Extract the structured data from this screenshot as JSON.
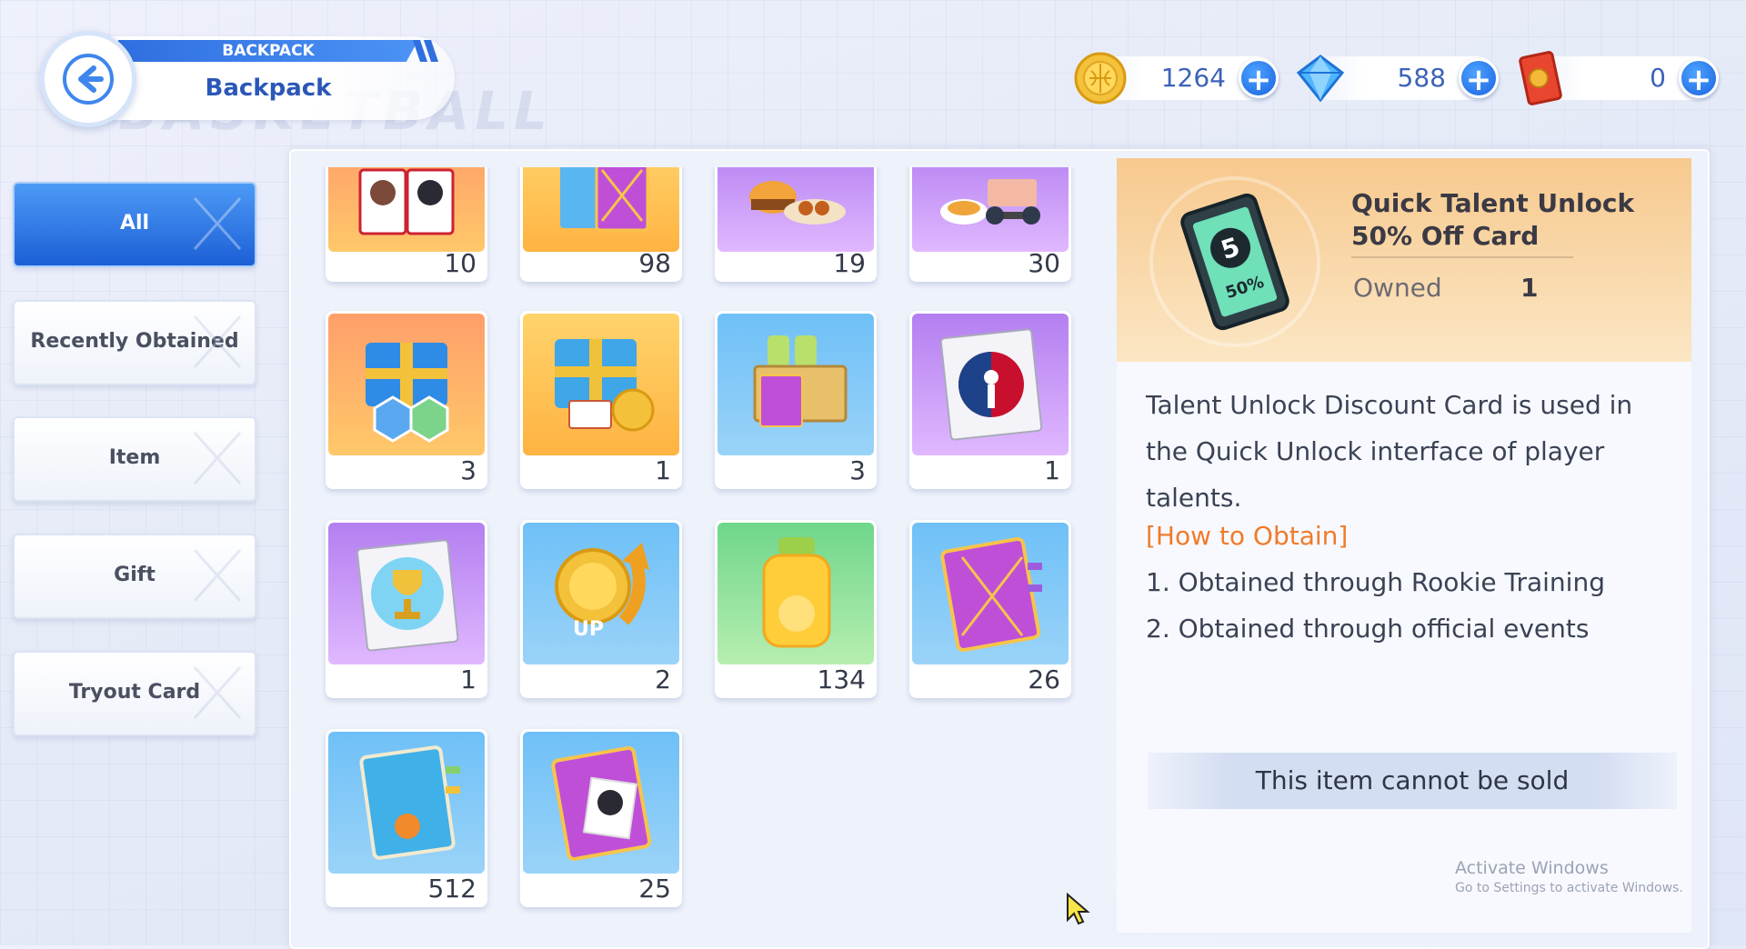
{
  "header": {
    "tag": "BACKPACK",
    "title": "Backpack",
    "watermark": "BASKETBALL"
  },
  "currencies": [
    {
      "name": "coin",
      "amount": "1264"
    },
    {
      "name": "diamond",
      "amount": "588"
    },
    {
      "name": "ticket",
      "amount": "0"
    }
  ],
  "sidebar": {
    "items": [
      {
        "label": "All",
        "active": true
      },
      {
        "label": "Recently Obtained"
      },
      {
        "label": "Item"
      },
      {
        "label": "Gift"
      },
      {
        "label": "Tryout Card"
      }
    ]
  },
  "items": [
    {
      "count": "10",
      "icon": "player-cards-icon"
    },
    {
      "count": "98",
      "icon": "skill-book-icon"
    },
    {
      "count": "19",
      "icon": "food-platter-icon"
    },
    {
      "count": "30",
      "icon": "training-meal-icon"
    },
    {
      "count": "3",
      "icon": "gift-box-badges-icon"
    },
    {
      "count": "1",
      "icon": "gift-box-coin-icon"
    },
    {
      "count": "3",
      "icon": "supply-crate-icon"
    },
    {
      "count": "1",
      "icon": "nba-badge-card-icon"
    },
    {
      "count": "1",
      "icon": "trophy-card-icon"
    },
    {
      "count": "2",
      "icon": "coin-up-icon"
    },
    {
      "count": "134",
      "icon": "juice-bottle-icon"
    },
    {
      "count": "26",
      "icon": "purple-book-icon"
    },
    {
      "count": "512",
      "icon": "blue-notebook-icon"
    },
    {
      "count": "25",
      "icon": "player-book-icon"
    }
  ],
  "detail": {
    "name": "Quick Talent Unlock 50% Off Card",
    "owned_label": "Owned",
    "owned_value": "1",
    "card_badge": "50%",
    "description": "Talent Unlock Discount Card is used in the Quick Unlock interface of player talents.",
    "obtain_title": "[How to Obtain]",
    "obtain_lines": [
      "1. Obtained through Rookie Training",
      "2. Obtained through official events"
    ],
    "sell_status": "This item cannot be sold"
  },
  "system_watermark": {
    "line1": "Activate Windows",
    "line2": "Go to Settings to activate Windows."
  },
  "colors": {
    "accent": "#2f6fe0",
    "obtain": "#f07b2a"
  }
}
